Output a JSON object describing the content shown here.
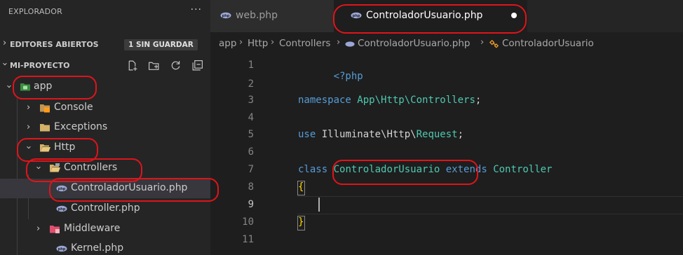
{
  "sidebar": {
    "title": "EXPLORADOR",
    "more": "···",
    "open_editors": {
      "label": "EDITORES ABIERTOS",
      "badge": "1 SIN GUARDAR"
    },
    "project": {
      "label": "MI-PROYECTO"
    },
    "tree": {
      "app": "app",
      "console": "Console",
      "exceptions": "Exceptions",
      "http": "Http",
      "controllers": "Controllers",
      "controlador_usuario": "ControladorUsuario.php",
      "controller": "Controller.php",
      "middleware": "Middleware",
      "kernel": "Kernel.php"
    }
  },
  "tabs": [
    {
      "label": "web.php"
    },
    {
      "label": "ControladorUsuario.php"
    }
  ],
  "breadcrumb": {
    "app": "app",
    "http": "Http",
    "controllers": "Controllers",
    "file": "ControladorUsuario.php",
    "symbol": "ControladorUsuario"
  },
  "code": {
    "line_numbers": [
      "1",
      "2",
      "3",
      "4",
      "5",
      "6",
      "7",
      "8",
      "9",
      "10",
      "11"
    ],
    "l1": "<?php",
    "l3_kw": "namespace",
    "l3_ns": "App\\Http\\Controllers",
    "l3_end": ";",
    "l5_kw": "use",
    "l5_ns": "Illuminate\\Http\\",
    "l5_cls": "Request",
    "l5_end": ";",
    "l7_kw": "class",
    "l7_name": "ControladorUsuario",
    "l7_ext": "extends",
    "l7_parent": "Controller",
    "l8": "{",
    "l10": "}"
  },
  "colors": {
    "background": "#1e1e1e",
    "sidebar": "#252526",
    "keyword": "#569cd6",
    "type": "#4ec9b0",
    "bracket": "#ffd700",
    "annotation": "#e0141a"
  }
}
